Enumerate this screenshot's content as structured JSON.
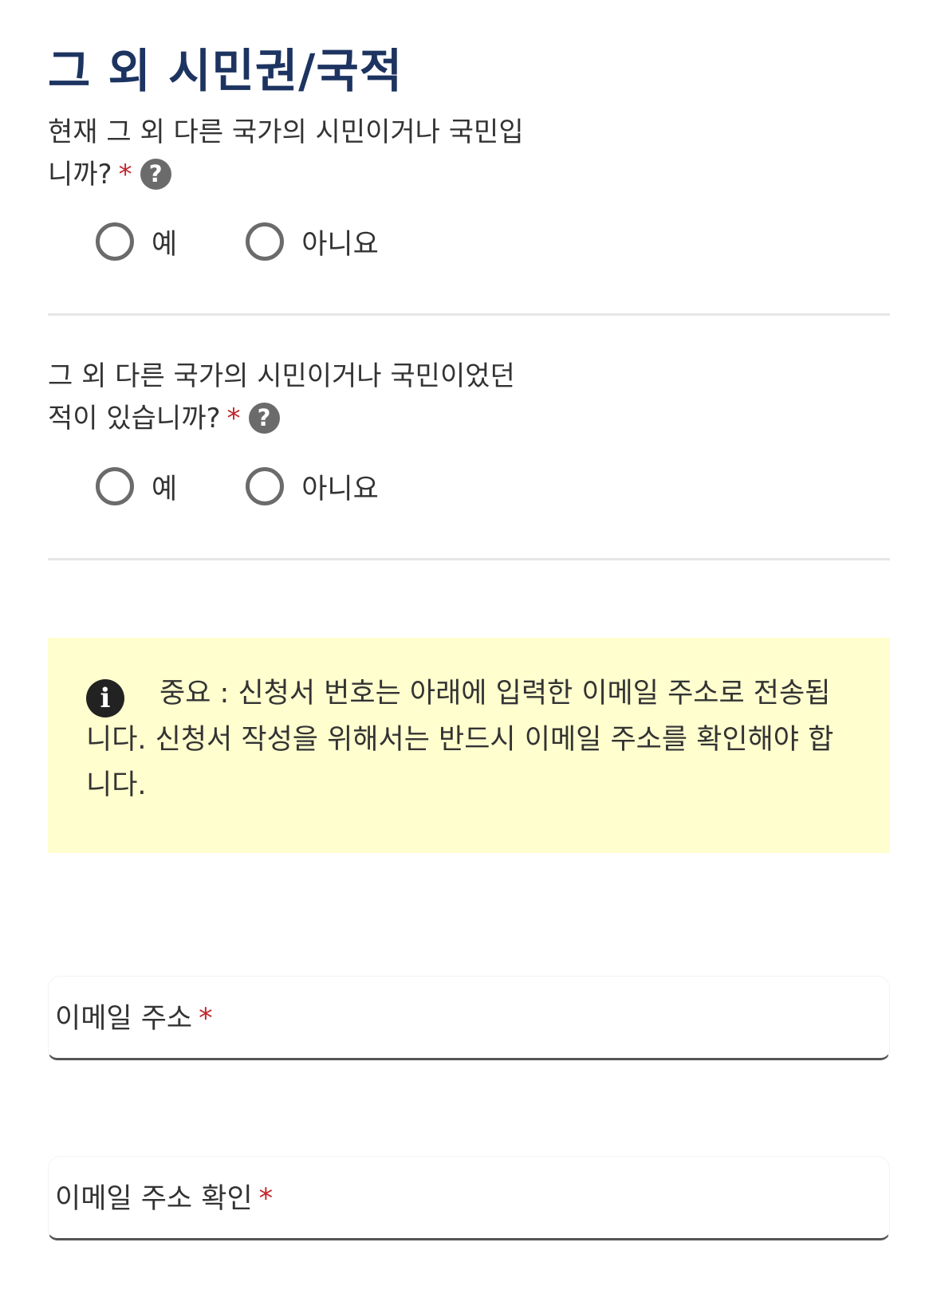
{
  "section": {
    "title": "그 외 시민권/국적"
  },
  "questions": [
    {
      "text": "현재 그 외 다른 국가의 시민이거나 국민입니까?",
      "required_mark": "*",
      "help_icon": "?",
      "options": [
        "예",
        "아니요"
      ],
      "selected": null
    },
    {
      "text": "그 외 다른 국가의 시민이거나 국민이었던 적이 있습니까?",
      "required_mark": "*",
      "help_icon": "?",
      "options": [
        "예",
        "아니요"
      ],
      "selected": null
    }
  ],
  "notice": {
    "icon": "i",
    "text": "중요 : 신청서 번호는 아래에 입력한 이메일 주소로 전송됩니다. 신청서 작성을 위해서는 반드시 이메일 주소를 확인해야 합니다."
  },
  "fields": [
    {
      "label": "이메일 주소",
      "required_mark": "*",
      "value": ""
    },
    {
      "label": "이메일 주소 확인",
      "required_mark": "*",
      "value": ""
    }
  ],
  "colors": {
    "title": "#1d3461",
    "required": "#c0272d",
    "notice_background": "#fefece",
    "icon_gray": "#6b6b6b"
  },
  "icons": {
    "help": "question-circle-icon",
    "notice": "info-circle-icon",
    "radio": "radio-empty-icon"
  }
}
